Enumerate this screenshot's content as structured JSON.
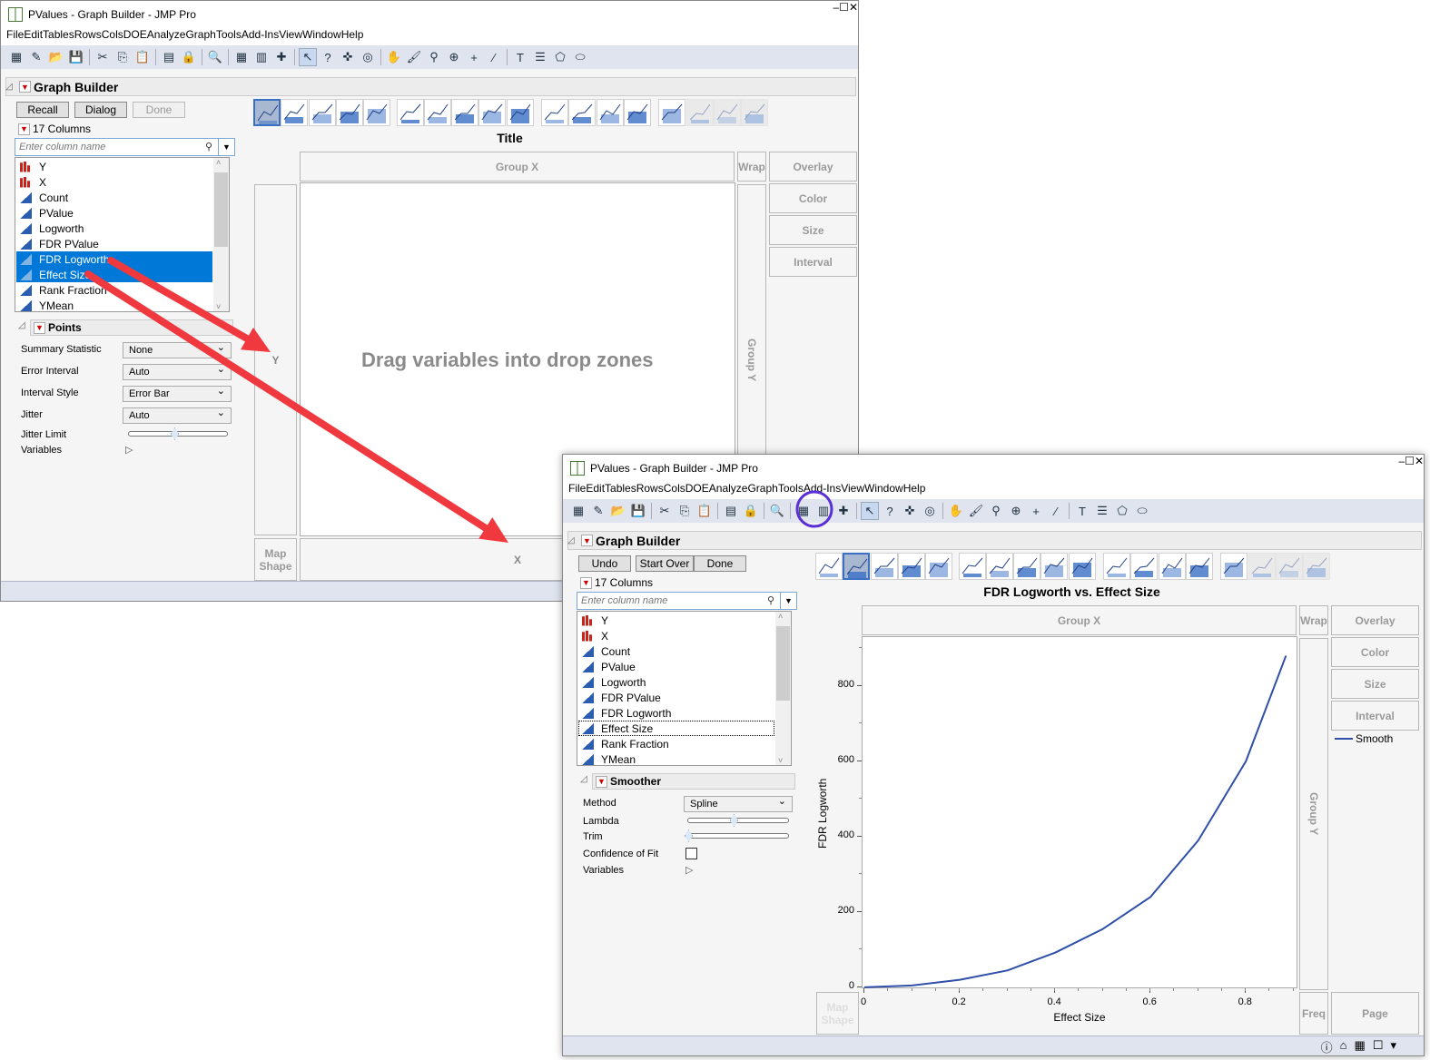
{
  "windows": [
    {
      "title": "PValues - Graph Builder - JMP Pro",
      "window_controls": [
        "–",
        "☐",
        "✕"
      ],
      "menu": [
        "File",
        "Edit",
        "Tables",
        "Rows",
        "Cols",
        "DOE",
        "Analyze",
        "Graph",
        "Tools",
        "Add-Ins",
        "View",
        "Window",
        "Help"
      ],
      "header": "Graph Builder",
      "buttons": [
        {
          "label": "Recall",
          "disabled": false
        },
        {
          "label": "Dialog",
          "disabled": false
        },
        {
          "label": "Done",
          "disabled": true
        }
      ],
      "columns_label": "17 Columns",
      "search_placeholder": "Enter column name",
      "columns": [
        {
          "name": "Y",
          "type": "nominal"
        },
        {
          "name": "X",
          "type": "nominal"
        },
        {
          "name": "Count",
          "type": "continuous"
        },
        {
          "name": "PValue",
          "type": "continuous"
        },
        {
          "name": "Logworth",
          "type": "continuous"
        },
        {
          "name": "FDR PValue",
          "type": "continuous"
        },
        {
          "name": "FDR Logworth",
          "type": "continuous",
          "selected": true
        },
        {
          "name": "Effect Size",
          "type": "continuous",
          "selected": true
        },
        {
          "name": "Rank Fraction",
          "type": "continuous"
        },
        {
          "name": "YMean",
          "type": "continuous"
        }
      ],
      "panel": {
        "title": "Points",
        "options": [
          {
            "label": "Summary Statistic",
            "kind": "select",
            "value": "None"
          },
          {
            "label": "Error Interval",
            "kind": "select",
            "value": "Auto"
          },
          {
            "label": "Interval Style",
            "kind": "select",
            "value": "Error Bar"
          },
          {
            "label": "Jitter",
            "kind": "select",
            "value": "Auto"
          },
          {
            "label": "Jitter Limit",
            "kind": "slider",
            "value": 0.5
          },
          {
            "label": "Variables",
            "kind": "expand"
          }
        ]
      },
      "chart_types_selected": 0,
      "graph": {
        "title": "Title",
        "group_x": "Group X",
        "wrap": "Wrap",
        "overlay": "Overlay",
        "color": "Color",
        "size": "Size",
        "interval": "Interval",
        "y_zone": "Y",
        "x_zone": "X",
        "group_y": "Group Y",
        "map_shape": "Map Shape",
        "drop_message": "Drag variables into drop zones"
      }
    },
    {
      "title": "PValues - Graph Builder - JMP Pro",
      "window_controls": [
        "–",
        "☐",
        "✕"
      ],
      "menu": [
        "File",
        "Edit",
        "Tables",
        "Rows",
        "Cols",
        "DOE",
        "Analyze",
        "Graph",
        "Tools",
        "Add-Ins",
        "View",
        "Window",
        "Help"
      ],
      "header": "Graph Builder",
      "buttons": [
        {
          "label": "Undo",
          "disabled": false
        },
        {
          "label": "Start Over",
          "disabled": false
        },
        {
          "label": "Done",
          "disabled": false
        }
      ],
      "columns_label": "17 Columns",
      "search_placeholder": "Enter column name",
      "columns": [
        {
          "name": "Y",
          "type": "nominal"
        },
        {
          "name": "X",
          "type": "nominal"
        },
        {
          "name": "Count",
          "type": "continuous"
        },
        {
          "name": "PValue",
          "type": "continuous"
        },
        {
          "name": "Logworth",
          "type": "continuous"
        },
        {
          "name": "FDR PValue",
          "type": "continuous"
        },
        {
          "name": "FDR Logworth",
          "type": "continuous"
        },
        {
          "name": "Effect Size",
          "type": "continuous",
          "focused": true
        },
        {
          "name": "Rank Fraction",
          "type": "continuous"
        },
        {
          "name": "YMean",
          "type": "continuous"
        }
      ],
      "panel": {
        "title": "Smoother",
        "options": [
          {
            "label": "Method",
            "kind": "select",
            "value": "Spline"
          },
          {
            "label": "Lambda",
            "kind": "slider",
            "value": 0.5
          },
          {
            "label": "Trim",
            "kind": "slider",
            "value": 0
          },
          {
            "label": "Confidence of Fit",
            "kind": "checkbox",
            "value": false
          },
          {
            "label": "Variables",
            "kind": "expand"
          }
        ]
      },
      "chart_types_selected": 1,
      "graph": {
        "title": "FDR Logworth vs. Effect Size",
        "group_x": "Group X",
        "wrap": "Wrap",
        "overlay": "Overlay",
        "color": "Color",
        "size": "Size",
        "interval": "Interval",
        "group_y": "Group Y",
        "map_shape": "Map Shape",
        "freq": "Freq",
        "page": "Page",
        "legend": "Smooth"
      }
    }
  ],
  "highlight_color": "#5b2fd6",
  "arrow_color": "#f0393f",
  "chart_data": {
    "type": "line",
    "title": "FDR Logworth vs. Effect Size",
    "xlabel": "Effect Size",
    "ylabel": "FDR Logworth",
    "xlim": [
      -0.004,
      0.91
    ],
    "ylim": [
      -5,
      930
    ],
    "xticks": [
      0,
      0.2,
      0.4,
      0.6,
      0.8
    ],
    "yticks": [
      0,
      200,
      400,
      600,
      800
    ],
    "grid": false,
    "legend_position": "right",
    "series": [
      {
        "name": "Smooth",
        "color": "#2f4fa8",
        "x": [
          0,
          0.1,
          0.2,
          0.3,
          0.4,
          0.5,
          0.6,
          0.7,
          0.8,
          0.884
        ],
        "y": [
          0,
          5,
          20,
          45,
          92,
          155,
          240,
          390,
          600,
          880
        ]
      }
    ]
  }
}
